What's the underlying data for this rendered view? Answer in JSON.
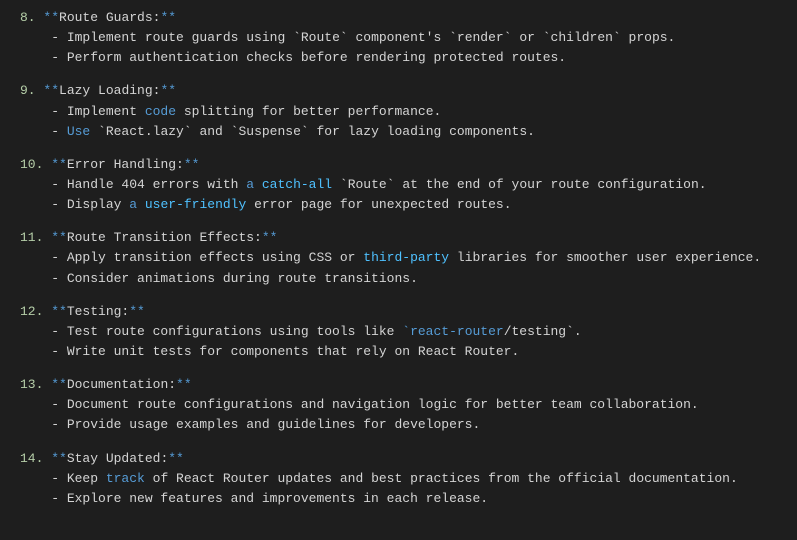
{
  "sections": [
    {
      "num": "8",
      "title": "Route Guards:",
      "bullets": [
        {
          "pre": "Implement route guards using ",
          "code1": "`Route`",
          "mid1": " component's ",
          "code2": "`render`",
          "mid2": " or ",
          "code3": "`children`",
          "post": " props."
        },
        {
          "pre": "Perform authentication checks before rendering protected routes."
        }
      ]
    },
    {
      "num": "9",
      "title": "Lazy Loading:",
      "bullets": [
        {
          "pre": "Implement ",
          "hl1": "code",
          "post1": " splitting for better performance."
        },
        {
          "kw": "Use",
          "pre": " ",
          "code1": "`React.lazy`",
          "mid1": " and ",
          "code2": "`Suspense`",
          "post": " for lazy loading components."
        }
      ]
    },
    {
      "num": "10",
      "title": "Error Handling:",
      "bullets": [
        {
          "pre": "Handle 404 errors with ",
          "hl1": "a",
          "mid1": " ",
          "link1": "catch-all",
          "mid2": " ",
          "code1": "`Route`",
          "post": " at the end of your route configuration."
        },
        {
          "pre": "Display ",
          "hl1": "a",
          "mid1": " ",
          "link1": "user-friendly",
          "post": " error page for unexpected routes."
        }
      ]
    },
    {
      "num": "11",
      "title": "Route Transition Effects:",
      "bullets": [
        {
          "pre": "Apply transition effects using CSS or ",
          "link1": "third-party",
          "post": " libraries for smoother user experience."
        },
        {
          "pre": "Consider animations during route transitions."
        }
      ]
    },
    {
      "num": "12",
      "title": "Testing:",
      "bullets": [
        {
          "pre": "Test route configurations using tools like ",
          "codehl": "`react-router",
          "codetail": "/testing`",
          "post": "."
        },
        {
          "pre": "Write unit tests for components that rely on React Router."
        }
      ]
    },
    {
      "num": "13",
      "title": "Documentation:",
      "bullets": [
        {
          "pre": "Document route configurations and navigation logic for better team collaboration."
        },
        {
          "pre": "Provide usage examples and guidelines for developers."
        }
      ]
    },
    {
      "num": "14",
      "title": "Stay Updated:",
      "bullets": [
        {
          "pre": "Keep ",
          "hl1": "track",
          "post1": " of React Router updates and best practices from the official documentation."
        },
        {
          "pre": "Explore new features and improvements in each release."
        }
      ]
    }
  ]
}
